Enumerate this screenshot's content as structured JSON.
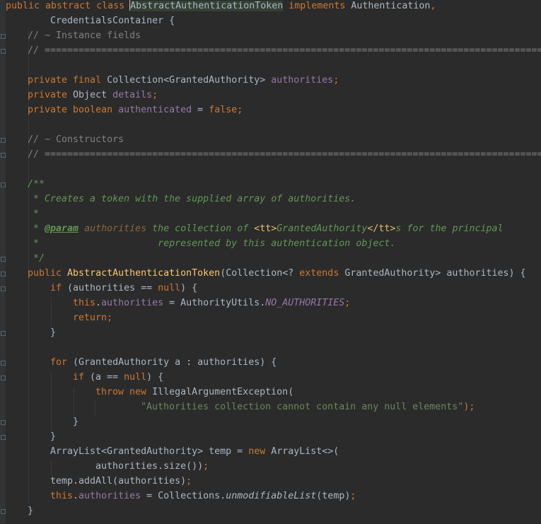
{
  "editor": {
    "language": "Java",
    "theme_colors": {
      "background": "#2b2b2b",
      "default_text": "#a9b7c6",
      "keyword": "#cc7832",
      "field": "#9876aa",
      "method_declaration": "#ffc66d",
      "string": "#6a8759",
      "line_comment": "#808080",
      "doc_comment": "#629755"
    }
  },
  "code": {
    "l1": {
      "kw1": "public abstract class ",
      "name": "AbstractAuthenticationToken",
      "kw2": " implements ",
      "iface": "Authentication",
      "comma": ","
    },
    "l2": {
      "iface": "CredentialsContainer",
      "brace": " {"
    },
    "l3": {
      "comment": "// ~ Instance fields"
    },
    "l4": {
      "comment": "// =================================================================================================="
    },
    "l6": {
      "kw": "private final ",
      "type": "Collection<GrantedAuthority> ",
      "fld": "authorities",
      "semi": ";"
    },
    "l7": {
      "kw": "private ",
      "type": "Object ",
      "fld": "details",
      "semi": ";"
    },
    "l8": {
      "kw": "private boolean ",
      "fld": "authenticated",
      "eq": " = ",
      "val": "false",
      "semi": ";"
    },
    "l10": {
      "comment": "// ~ Constructors"
    },
    "l11": {
      "comment": "// =================================================================================================="
    },
    "l13": {
      "doc": "/**"
    },
    "l14": {
      "doc": " * Creates a token with the supplied array of authorities."
    },
    "l15": {
      "doc": " *"
    },
    "l16": {
      "pre": " * ",
      "tag": "@param",
      "sp": " ",
      "param": "authorities",
      "txt1": " the collection of ",
      "tt1": "<tt>",
      "mid": "GrantedAuthority",
      "tt2": "</tt>",
      "txt2": "s for the principal"
    },
    "l17": {
      "doc": " *                     represented by this authentication object."
    },
    "l18": {
      "doc": " */"
    },
    "l19": {
      "kw": "public ",
      "name": "AbstractAuthenticationToken",
      "p1": "(Collection<? ",
      "kw2": "extends",
      "p2": " GrantedAuthority> authorities) {"
    },
    "l20": {
      "kw": "if",
      "p1": " (authorities == ",
      "nul": "null",
      "p2": ") {"
    },
    "l21": {
      "kw": "this",
      "dot": ".",
      "fld": "authorities",
      "eq": " = AuthorityUtils.",
      "sfld": "NO_AUTHORITIES",
      "semi": ";"
    },
    "l22": {
      "kw": "return",
      "semi": ";"
    },
    "l23": {
      "brace": "}"
    },
    "l25": {
      "kw": "for",
      "rest": " (GrantedAuthority a : authorities) {"
    },
    "l26": {
      "kw": "if",
      "p1": " (a == ",
      "nul": "null",
      "p2": ") {"
    },
    "l27": {
      "kw": "throw new ",
      "rest": "IllegalArgumentException("
    },
    "l28": {
      "str": "\"Authorities collection cannot contain any null elements\"",
      "end": ");"
    },
    "l29": {
      "brace": "}"
    },
    "l30": {
      "brace": "}"
    },
    "l31": {
      "p1": "ArrayList<GrantedAuthority> temp = ",
      "kw": "new ",
      "p2": "ArrayList<>("
    },
    "l32": {
      "p1": "authorities.size())",
      "semi": ";"
    },
    "l33": {
      "p1": "temp.addAll(authorities)",
      "semi": ";"
    },
    "l34": {
      "kw": "this",
      "dot": ".",
      "fld": "authorities",
      "eq": " = Collections.",
      "it": "unmodifiableList",
      "p2": "(temp)",
      "semi": ";"
    },
    "l35": {
      "brace": "}"
    }
  }
}
